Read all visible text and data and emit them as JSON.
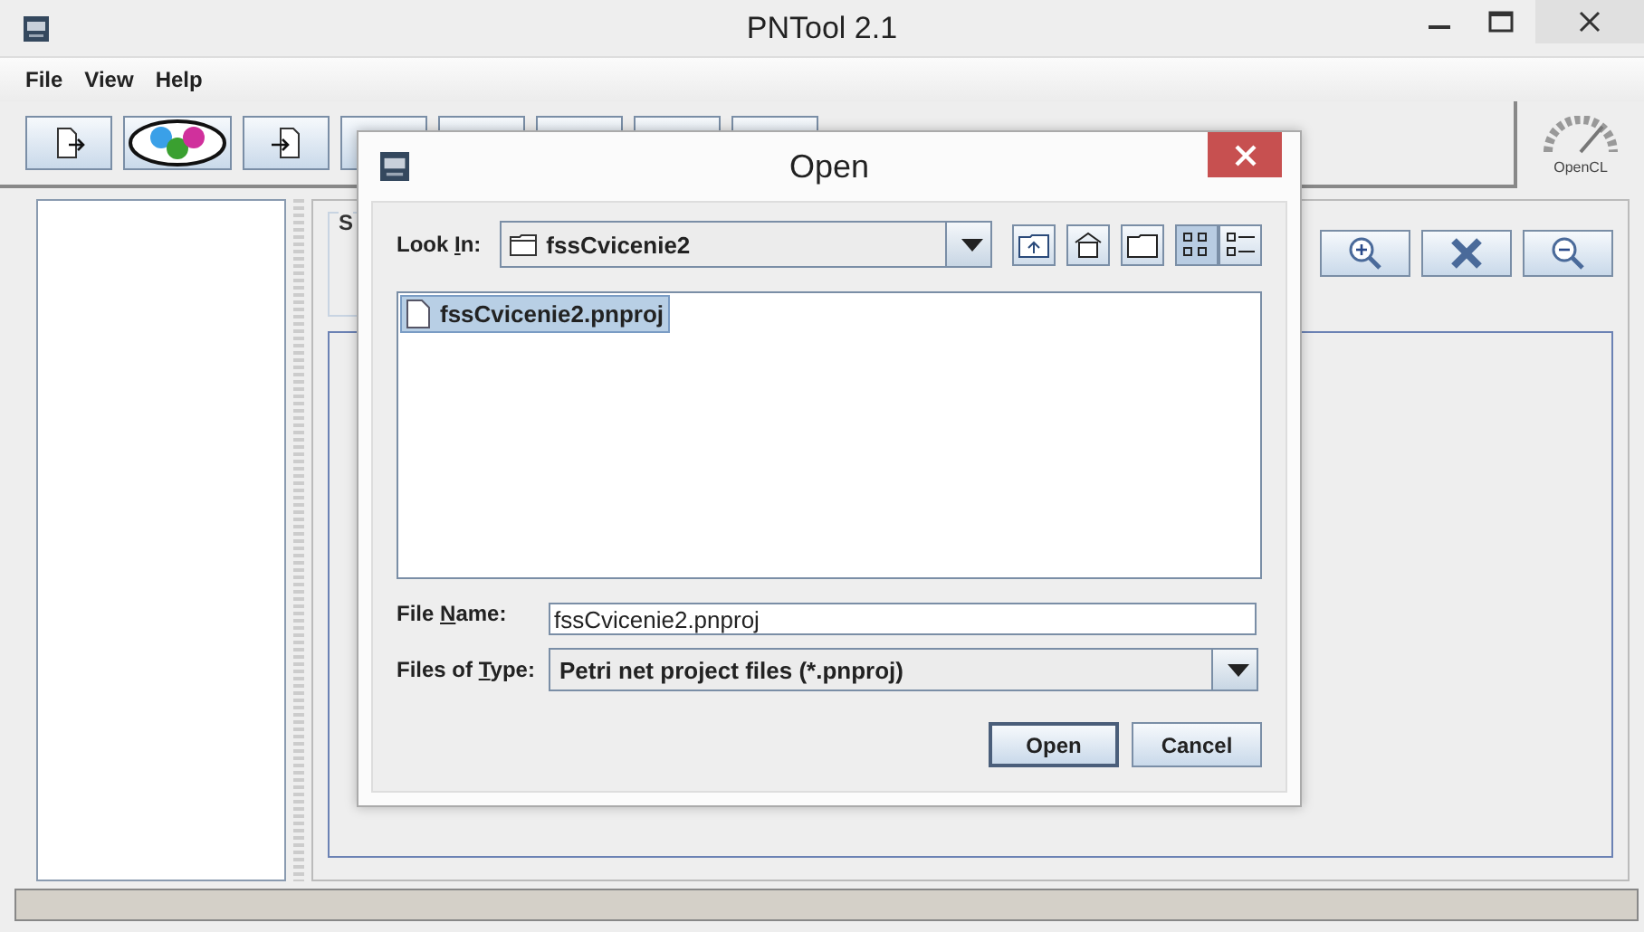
{
  "window": {
    "title": "PNTool 2.1"
  },
  "menu": [
    "File",
    "View",
    "Help"
  ],
  "toolbar": [
    {
      "kind": "export"
    },
    {
      "kind": "cpn"
    },
    {
      "kind": "import"
    },
    {
      "kind": "plain"
    },
    {
      "kind": "plain"
    },
    {
      "kind": "plain"
    },
    {
      "kind": "plain"
    },
    {
      "kind": "plain"
    }
  ],
  "opencl": {
    "label": "OpenCL"
  },
  "panel": {
    "title": "S"
  },
  "canvas_tools": [
    {
      "kind": "zoom-in"
    },
    {
      "kind": "clear"
    },
    {
      "kind": "zoom-out"
    }
  ],
  "dialog": {
    "title": "Open",
    "look_in": {
      "label_parts": [
        "Look ",
        "I",
        "n:"
      ],
      "value": "fssCvicenie2"
    },
    "nav_buttons": [
      {
        "kind": "up"
      },
      {
        "kind": "home"
      },
      {
        "kind": "new-folder"
      },
      {
        "kind": "list",
        "selected": true
      },
      {
        "kind": "details",
        "selected": false
      }
    ],
    "files": [
      {
        "name": "fssCvicenie2.pnproj",
        "selected": true
      }
    ],
    "file_name": {
      "label_parts": [
        "File ",
        "N",
        "ame:"
      ],
      "value": "fssCvicenie2.pnproj"
    },
    "file_type": {
      "label_parts": [
        "Files of ",
        "T",
        "ype:"
      ],
      "value": "Petri net project files (*.pnproj)"
    },
    "buttons": [
      {
        "label": "Open",
        "default": true
      },
      {
        "label": "Cancel",
        "default": false
      }
    ]
  }
}
